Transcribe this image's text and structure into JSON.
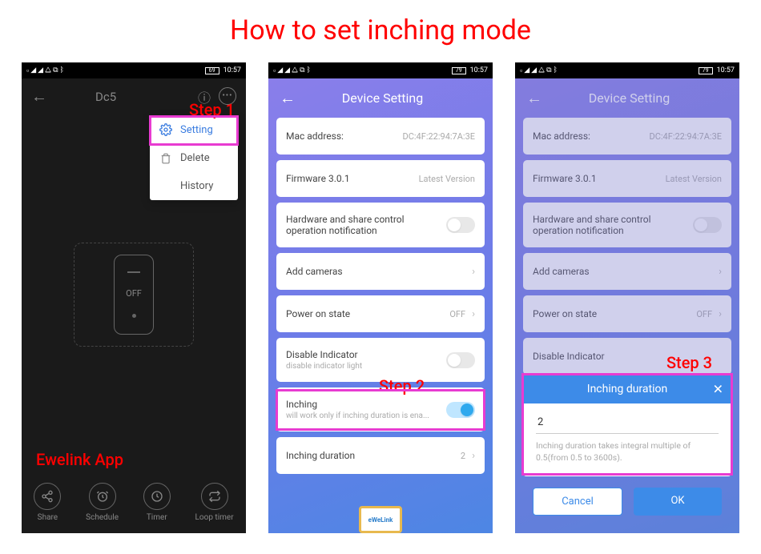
{
  "page_title": "How to set inching mode",
  "annotations": {
    "step1": "Step 1",
    "step2": "Step 2",
    "step3": "Step 3",
    "app_label": "Ewelink App"
  },
  "status": {
    "battery1": "69",
    "battery2": "79",
    "battery3": "79",
    "time": "10:57"
  },
  "phone1": {
    "title": "Dc5",
    "menu": {
      "item1": "Setting",
      "item2": "Delete",
      "item3": "History"
    },
    "switch_state": "OFF",
    "tabs": {
      "share": "Share",
      "schedule": "Schedule",
      "timer": "Timer",
      "loop": "Loop timer"
    }
  },
  "phone2": {
    "header": "Device Setting",
    "rows": {
      "mac_label": "Mac address:",
      "mac_value": "DC:4F:22:94:7A:3E",
      "fw_label": "Firmware",
      "fw_ver": "3.0.1",
      "fw_status": "Latest Version",
      "hw_label": "Hardware and share control operation notification",
      "cam_label": "Add cameras",
      "poweron_label": "Power on state",
      "poweron_value": "OFF",
      "disable_label": "Disable Indicator",
      "disable_sub": "disable indicator light",
      "inching_label": "Inching",
      "inching_sub": "will work only if inching duration is ena...",
      "dur_label": "Inching duration",
      "dur_value": "2"
    }
  },
  "phone3": {
    "header": "Device Setting",
    "dialog": {
      "title": "Inching duration",
      "value": "2",
      "hint": "Inching duration takes integral multiple of 0.5(from 0.5 to 3600s).",
      "cancel": "Cancel",
      "ok": "OK"
    },
    "rows": {
      "mac_label": "Mac address:",
      "mac_value": "DC:4F:22:94:7A:3E",
      "fw_label": "Firmware",
      "fw_ver": "3.0.1",
      "fw_status": "Latest Version",
      "hw_label": "Hardware and share control operation notification",
      "cam_label": "Add cameras",
      "poweron_label": "Power on state",
      "poweron_value": "OFF",
      "disable_label": "Disable Indicator"
    }
  }
}
